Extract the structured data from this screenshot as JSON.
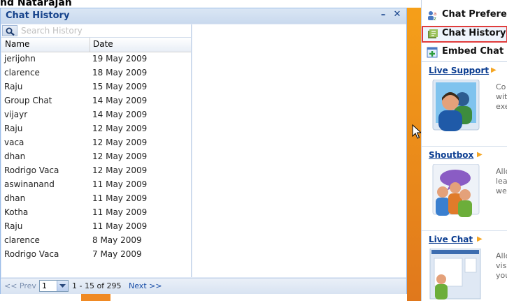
{
  "background": {
    "user_name": "nd Natarajan"
  },
  "window": {
    "title": "Chat History",
    "minimize_glyph": "–",
    "close_glyph": "✕"
  },
  "search": {
    "placeholder": "Search History",
    "icon": "search-icon"
  },
  "grid": {
    "columns": [
      "Name",
      "Date"
    ],
    "rows": [
      {
        "name": "jerijohn",
        "date": "19 May 2009"
      },
      {
        "name": "clarence",
        "date": "18 May 2009"
      },
      {
        "name": "Raju",
        "date": "15 May 2009"
      },
      {
        "name": "Group Chat",
        "date": "14 May 2009"
      },
      {
        "name": "vijayr",
        "date": "14 May 2009"
      },
      {
        "name": "Raju",
        "date": "12 May 2009"
      },
      {
        "name": "vaca",
        "date": "12 May 2009"
      },
      {
        "name": "dhan",
        "date": "12 May 2009"
      },
      {
        "name": "Rodrigo Vaca",
        "date": "12 May 2009"
      },
      {
        "name": "aswinanand",
        "date": "11 May 2009"
      },
      {
        "name": "dhan",
        "date": "11 May 2009"
      },
      {
        "name": "Kotha",
        "date": "11 May 2009"
      },
      {
        "name": "Raju",
        "date": "11 May 2009"
      },
      {
        "name": "clarence",
        "date": "8 May 2009"
      },
      {
        "name": "Rodrigo Vaca",
        "date": "7 May 2009"
      }
    ]
  },
  "pager": {
    "prev": "<< Prev",
    "page": "1",
    "range": "1 - 15 of 295",
    "next": "Next >>"
  },
  "sidebar": {
    "menu": [
      {
        "label": "Chat Preferences",
        "icon": "preferences-icon"
      },
      {
        "label": "Chat History",
        "icon": "history-icon",
        "active": true
      },
      {
        "label": "Embed Chat in",
        "icon": "embed-icon"
      }
    ],
    "sections": [
      {
        "title": "Live Support",
        "text": [
          "Co",
          "wit",
          "exe"
        ],
        "icon": "live-support-icon"
      },
      {
        "title": "Shoutbox",
        "text": [
          "Allo",
          "lea",
          "we"
        ],
        "icon": "shoutbox-icon"
      },
      {
        "title": "Live Chat",
        "text": [
          "Allo",
          "vis",
          "you"
        ],
        "icon": "live-chat-icon"
      }
    ]
  },
  "colors": {
    "window_title": "#15428b",
    "link_blue": "#0b3d91",
    "accent_orange": "#f5a623",
    "active_border": "#e03c3c"
  }
}
